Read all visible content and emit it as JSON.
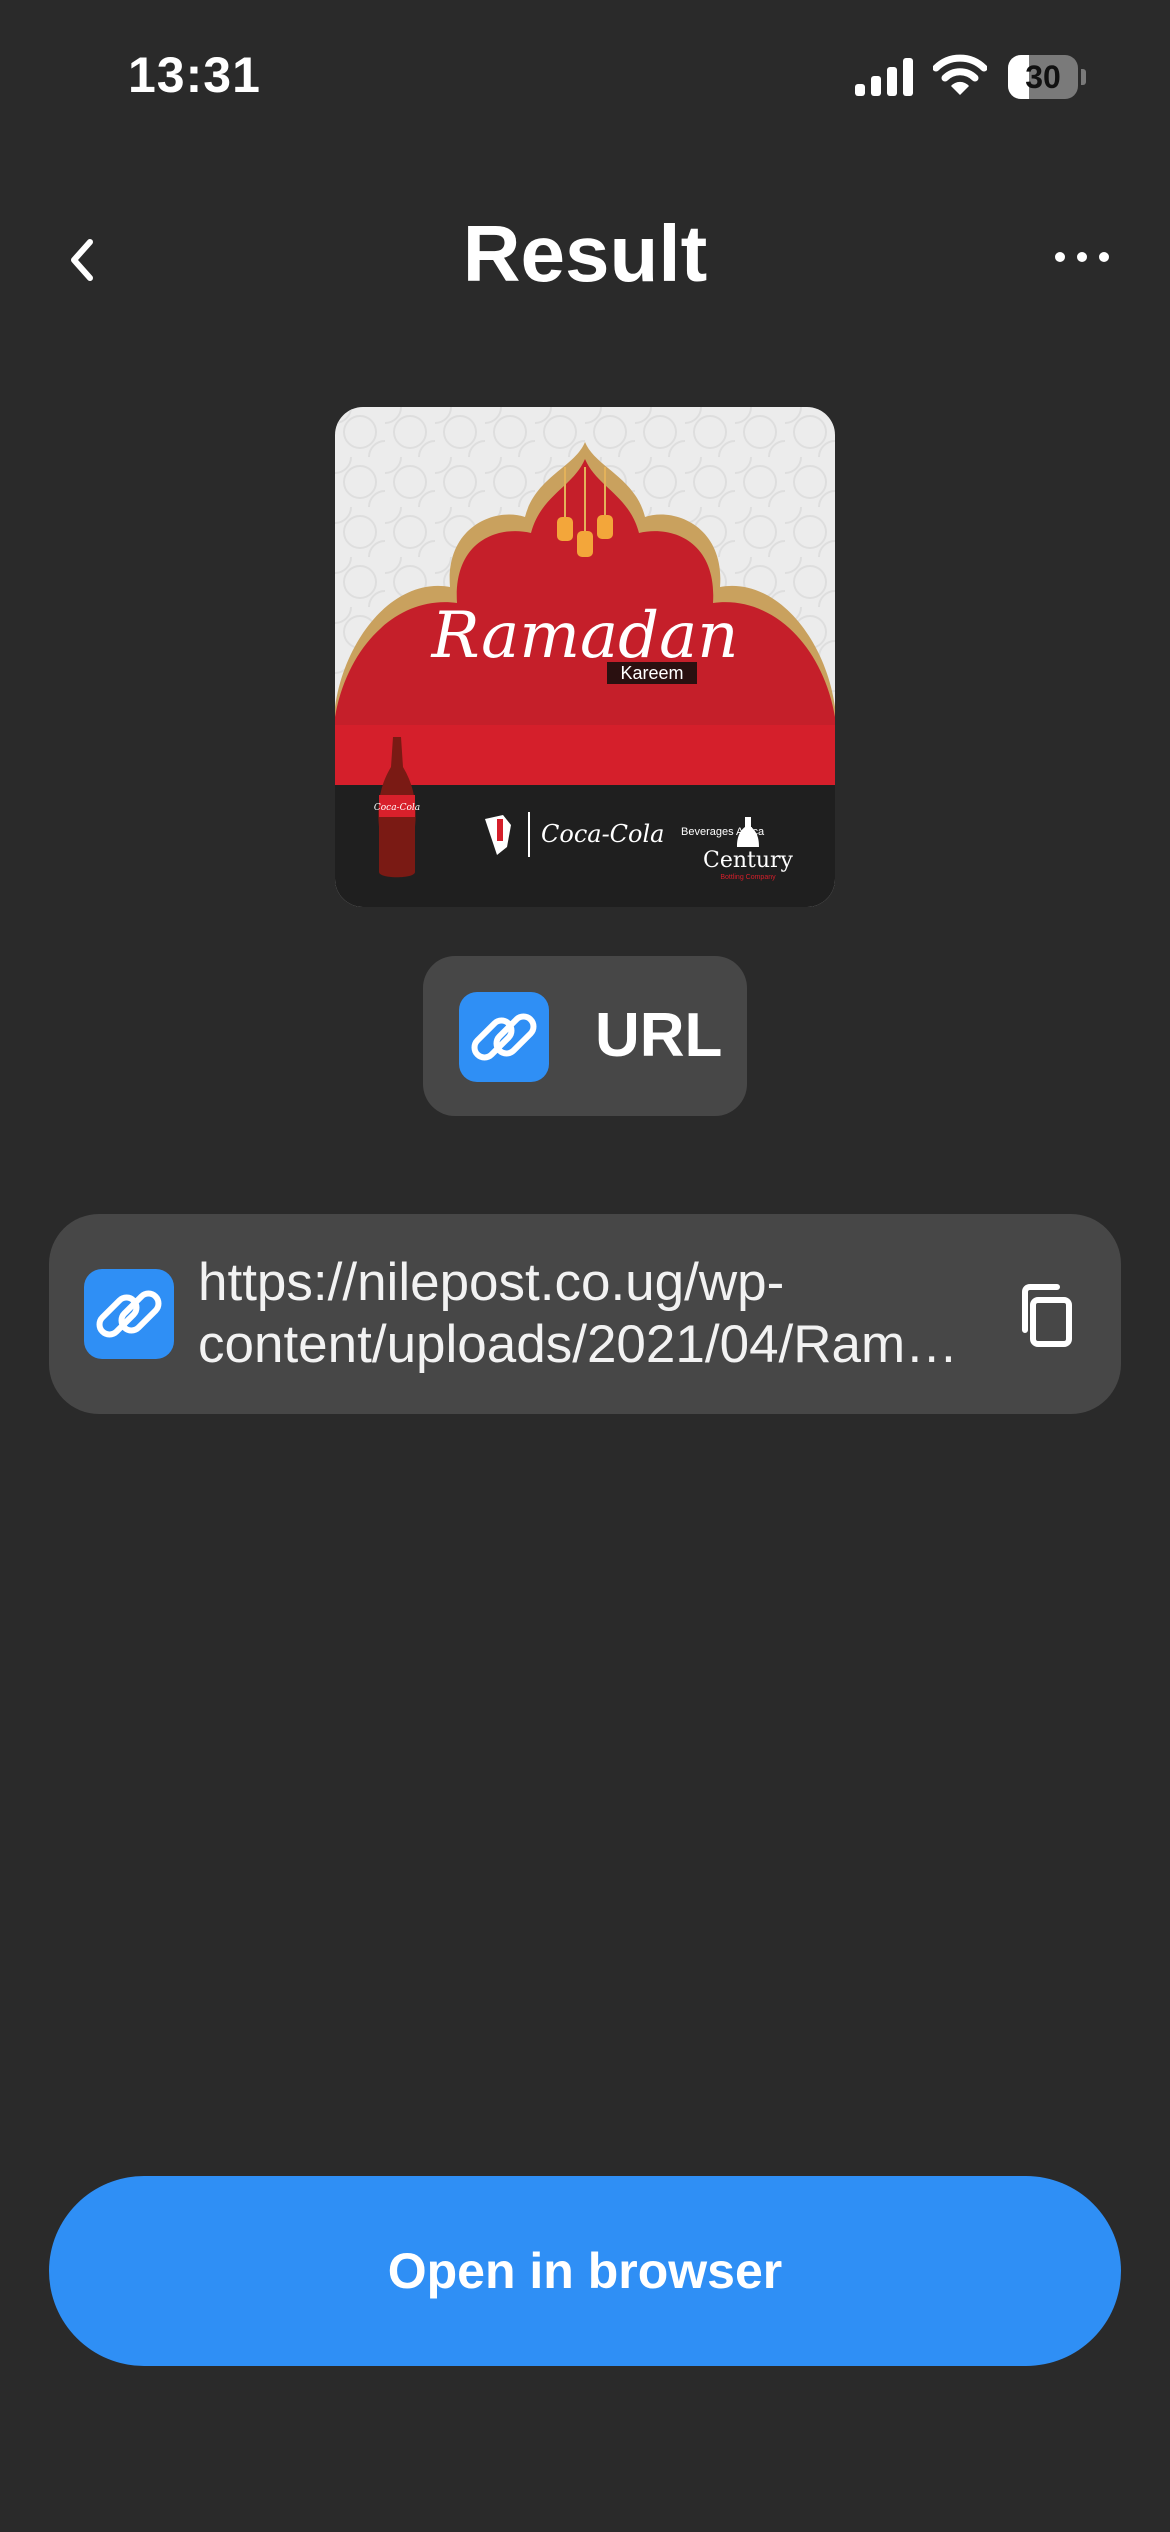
{
  "status_bar": {
    "time": "13:31",
    "battery_level": "30",
    "battery_fraction": 0.3
  },
  "header": {
    "title": "Result",
    "back_icon": "chevron-left-icon",
    "more_icon": "ellipsis-icon"
  },
  "preview": {
    "title_text": "Ramadan",
    "subtitle_text": "Kareem",
    "bottle_label": "Coca-Cola",
    "brand_logo": "Coca-Cola",
    "brand_side_text": "Beverages Africa",
    "partner_logo": "Century",
    "partner_sub": "Bottling Company"
  },
  "result_type": {
    "label": "URL",
    "icon": "link-icon"
  },
  "url_card": {
    "line1": "https://nilepost.co.ug/wp-",
    "line2": "content/uploads/2021/04/Ram…",
    "copy_icon": "copy-icon"
  },
  "actions": {
    "open_label": "Open in browser"
  },
  "colors": {
    "background": "#2a2a2a",
    "card": "#474747",
    "accent": "#2f8ff5"
  }
}
